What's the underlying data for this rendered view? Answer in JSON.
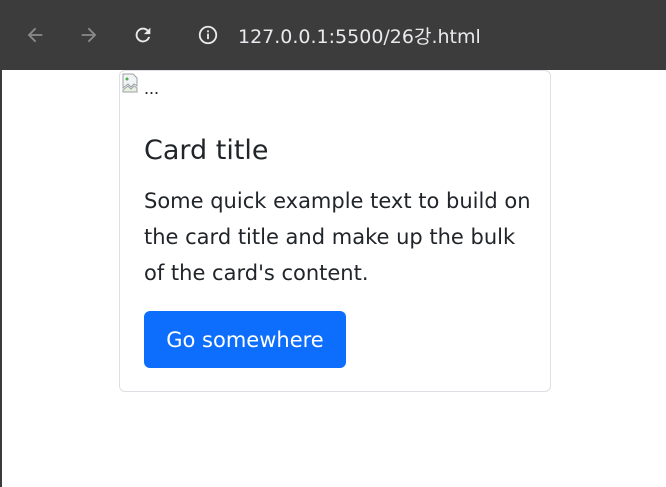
{
  "browser": {
    "url": "127.0.0.1:5500/26강.html",
    "icons": {
      "back": "arrow-left-icon",
      "forward": "arrow-right-icon",
      "reload": "reload-icon",
      "info": "info-icon"
    }
  },
  "card": {
    "image_alt": "...",
    "title": "Card title",
    "text": "Some quick example text to build on the card title and make up the bulk of the card's content.",
    "button_label": "Go somewhere"
  },
  "colors": {
    "toolbar_bg": "#3c3c3c",
    "primary": "#0d6efd",
    "text": "#212529"
  }
}
